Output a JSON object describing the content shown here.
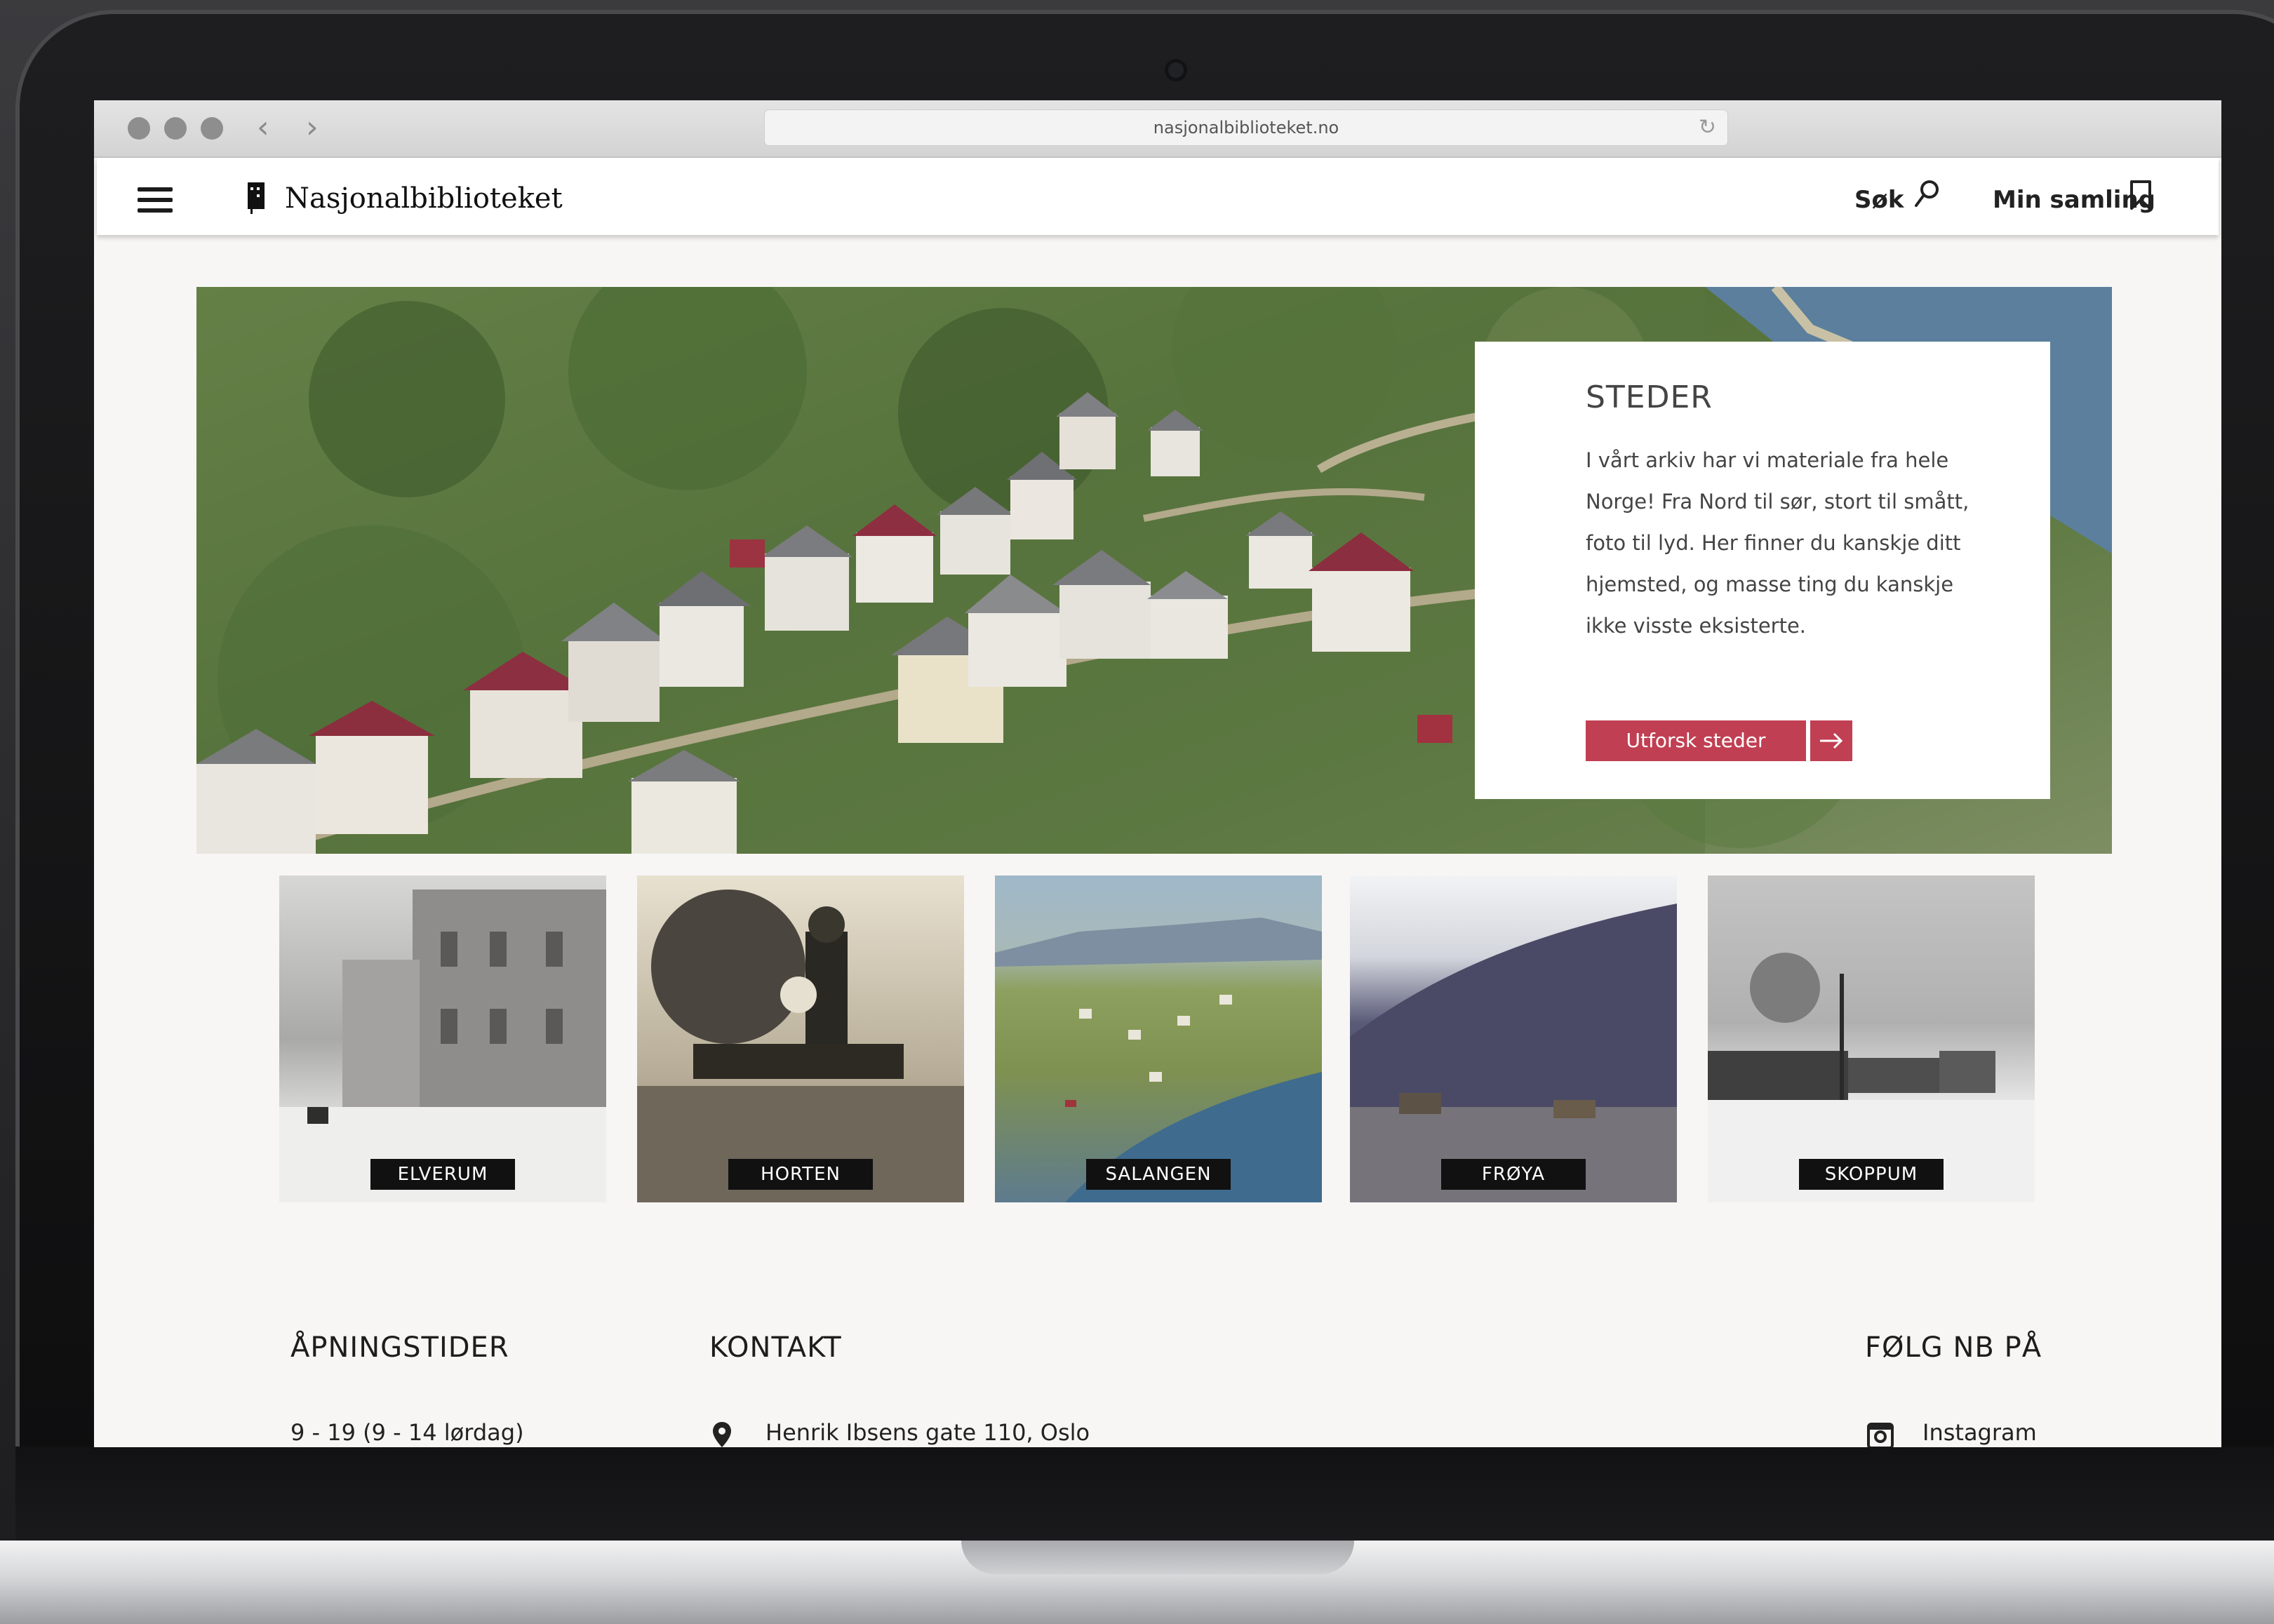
{
  "browser": {
    "url": "nasjonalbiblioteket.no",
    "back_label": "‹",
    "forward_label": "›",
    "reload_icon": "↻"
  },
  "header": {
    "logo_text": "Nasjonalbiblioteket",
    "search_label": "Søk",
    "collection_label": "Min samling"
  },
  "hero": {
    "title": "STEDER",
    "body": "I vårt arkiv har vi materiale fra hele Norge! Fra Nord til sør, stort til smått, foto til lyd. Her finner du kanskje ditt hjemsted, og masse ting du kanskje ikke visste eksisterte.",
    "button_label": "Utforsk steder",
    "button_color": "#c13f52"
  },
  "places": [
    {
      "label": "ELVERUM"
    },
    {
      "label": "HORTEN"
    },
    {
      "label": "SALANGEN"
    },
    {
      "label": "FRØYA"
    },
    {
      "label": "SKOPPUM"
    }
  ],
  "footer": {
    "hours_title": "ÅPNINGSTIDER",
    "hours_value": "9 - 19 (9 - 14 lørdag)",
    "contact_title": "KONTAKT",
    "contact_address": "Henrik Ibsens gate 110, Oslo",
    "follow_title": "FØLG NB PÅ",
    "follow_instagram": "Instagram"
  }
}
